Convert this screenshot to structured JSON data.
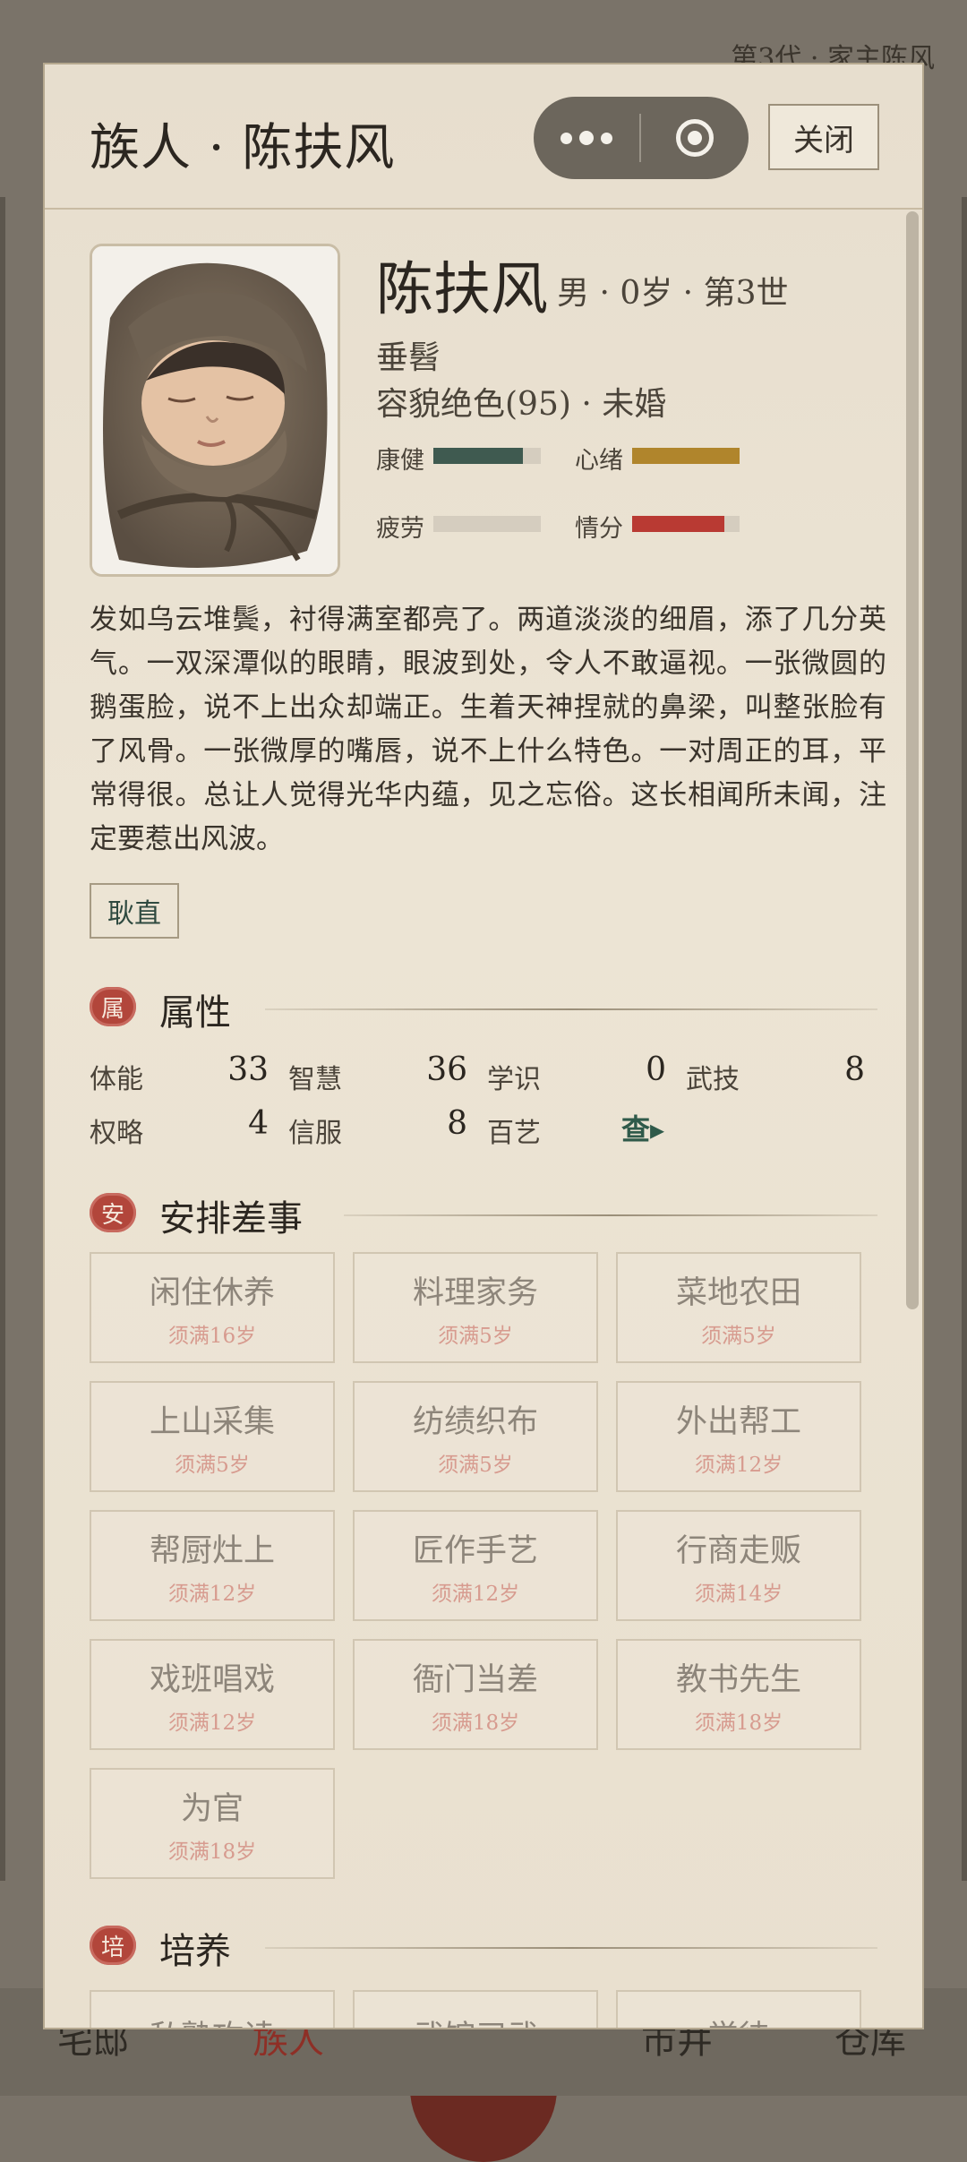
{
  "background": {
    "top_right": "第3代 · 家主陈风",
    "nav": [
      "宅邸",
      "族人",
      "市井",
      "仓库"
    ]
  },
  "header": {
    "title": "族人 · 陈扶风",
    "close_label": "关闭"
  },
  "profile": {
    "name": "陈扶风",
    "meta": "男 · 0岁 · 第3世",
    "stage": "垂髫",
    "looks": "容貌绝色(95) · 未婚",
    "portrait_icon": "swaddled-infant-portrait",
    "stats": [
      {
        "label": "康健",
        "value": 0.83,
        "color": "#3f5a50"
      },
      {
        "label": "心绪",
        "value": 1.0,
        "color": "#b0852c"
      },
      {
        "label": "疲劳",
        "value": 0.0,
        "color": "#8e8778"
      },
      {
        "label": "情分",
        "value": 0.86,
        "color": "#b93a33"
      }
    ],
    "description": "发如乌云堆鬓，衬得满室都亮了。两道淡淡的细眉，添了几分英气。一双深潭似的眼睛，眼波到处，令人不敢逼视。一张微圆的鹅蛋脸，说不上出众却端正。生着天神捏就的鼻梁，叫整张脸有了风骨。一张微厚的嘴唇，说不上什么特色。一对周正的耳，平常得很。总让人觉得光华内蕴，见之忘俗。这长相闻所未闻，注定要惹出风波。",
    "trait": "耿直"
  },
  "attributes": {
    "badge": "属",
    "title": "属性",
    "items": [
      {
        "label": "体能",
        "value": "33"
      },
      {
        "label": "智慧",
        "value": "36"
      },
      {
        "label": "学识",
        "value": "0"
      },
      {
        "label": "武技",
        "value": "8"
      },
      {
        "label": "权略",
        "value": "4"
      },
      {
        "label": "信服",
        "value": "8"
      },
      {
        "label": "百艺",
        "value": "查▸"
      }
    ]
  },
  "tasks": {
    "badge": "安",
    "title": "安排差事",
    "items": [
      {
        "name": "闲住休养",
        "req": "须满16岁"
      },
      {
        "name": "料理家务",
        "req": "须满5岁"
      },
      {
        "name": "菜地农田",
        "req": "须满5岁"
      },
      {
        "name": "上山采集",
        "req": "须满5岁"
      },
      {
        "name": "纺绩织布",
        "req": "须满5岁"
      },
      {
        "name": "外出帮工",
        "req": "须满12岁"
      },
      {
        "name": "帮厨灶上",
        "req": "须满12岁"
      },
      {
        "name": "匠作手艺",
        "req": "须满12岁"
      },
      {
        "name": "行商走贩",
        "req": "须满14岁"
      },
      {
        "name": "戏班唱戏",
        "req": "须满12岁"
      },
      {
        "name": "衙门当差",
        "req": "须满18岁"
      },
      {
        "name": "教书先生",
        "req": "须满18岁"
      },
      {
        "name": "为官",
        "req": "须满18岁"
      }
    ]
  },
  "training": {
    "badge": "培",
    "title": "培养",
    "items": [
      "私塾攻读",
      "武馆习武",
      "学徒"
    ]
  }
}
